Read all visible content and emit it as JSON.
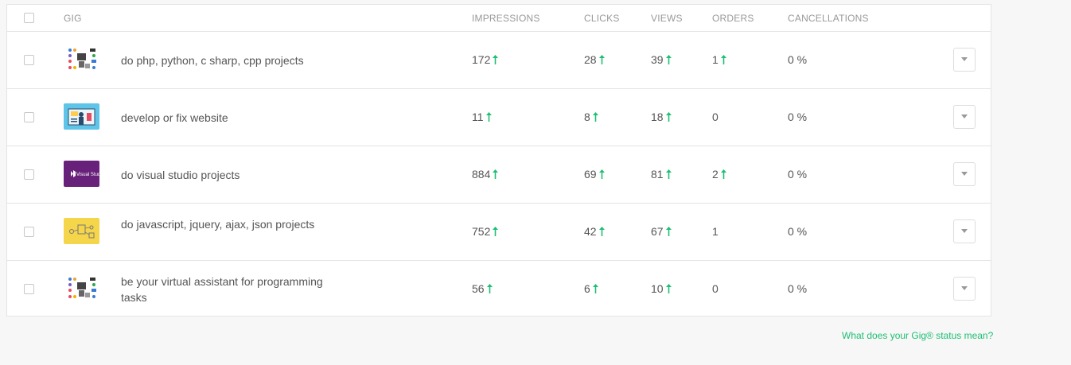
{
  "columns": {
    "gig": "GIG",
    "impressions": "IMPRESSIONS",
    "clicks": "CLICKS",
    "views": "VIEWS",
    "orders": "ORDERS",
    "cancellations": "CANCELLATIONS"
  },
  "rows": [
    {
      "title": "do php, python, c sharp, cpp projects",
      "impressions": "172",
      "impressions_up": true,
      "clicks": "28",
      "clicks_up": true,
      "views": "39",
      "views_up": true,
      "orders": "1",
      "orders_up": true,
      "cancellations": "0 %",
      "thumb": "programming"
    },
    {
      "title": "develop or fix website",
      "impressions": "11",
      "impressions_up": true,
      "clicks": "8",
      "clicks_up": true,
      "views": "18",
      "views_up": true,
      "orders": "0",
      "orders_up": false,
      "cancellations": "0 %",
      "thumb": "website"
    },
    {
      "title": "do visual studio projects",
      "impressions": "884",
      "impressions_up": true,
      "clicks": "69",
      "clicks_up": true,
      "views": "81",
      "views_up": true,
      "orders": "2",
      "orders_up": true,
      "cancellations": "0 %",
      "thumb": "visualstudio"
    },
    {
      "title": "do javascript, jquery, ajax, json projects",
      "impressions": "752",
      "impressions_up": true,
      "clicks": "42",
      "clicks_up": true,
      "views": "67",
      "views_up": true,
      "orders": "1",
      "orders_up": false,
      "cancellations": "0 %",
      "thumb": "javascript"
    },
    {
      "title": "be your virtual assistant for programming tasks",
      "impressions": "56",
      "impressions_up": true,
      "clicks": "6",
      "clicks_up": true,
      "views": "10",
      "views_up": true,
      "orders": "0",
      "orders_up": false,
      "cancellations": "0 %",
      "thumb": "programming"
    }
  ],
  "thumb_text": {
    "visualstudio": "Visual Studio"
  },
  "help_link": "What does your Gig® status mean?",
  "colors": {
    "up_arrow": "#1dbf73",
    "link": "#1dbf73",
    "vs_purple": "#68217a",
    "js_yellow": "#f5d54a",
    "web_blue": "#5ec4e8"
  },
  "icons": {
    "trend": "arrow-up-icon",
    "menu": "chevron-down-icon"
  }
}
